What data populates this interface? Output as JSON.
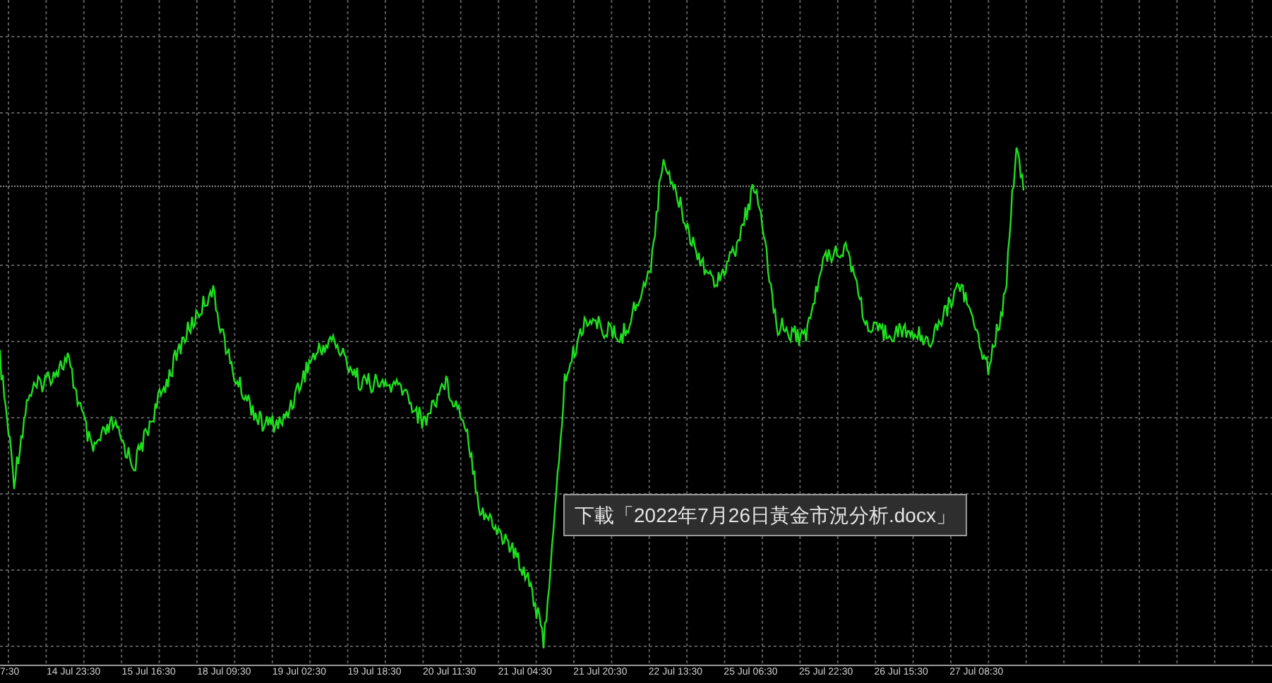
{
  "chart": {
    "x_labels": [
      "7:30",
      "14 Jul 23:30",
      "15 Jul 16:30",
      "18 Jul 09:30",
      "19 Jul 02:30",
      "19 Jul 18:30",
      "20 Jul 11:30",
      "21 Jul 04:30",
      "21 Jul 20:30",
      "22 Jul 13:30",
      "25 Jul 06:30",
      "25 Jul 22:30",
      "26 Jul 15:30",
      "27 Jul 08:30"
    ]
  },
  "tooltip": {
    "text": "下載「2022年7月26日黃金市況分析.docx」"
  }
}
